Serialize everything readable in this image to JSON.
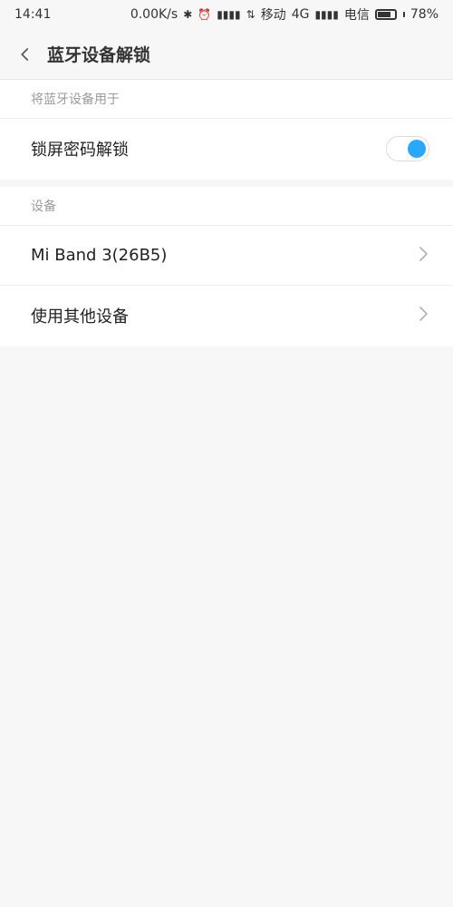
{
  "status": {
    "time": "14:41",
    "net_speed": "0.00K/s",
    "carrier1": "移动",
    "net_type": "4G",
    "carrier2": "电信",
    "battery_pct": "78%",
    "battery_level": 0.78
  },
  "header": {
    "title": "蓝牙设备解锁"
  },
  "section1": {
    "header": "将蓝牙设备用于",
    "rows": [
      {
        "label": "锁屏密码解锁",
        "toggle_on": true
      }
    ]
  },
  "section2": {
    "header": "设备",
    "rows": [
      {
        "label": "Mi Band 3(26B5)"
      },
      {
        "label": "使用其他设备"
      }
    ]
  },
  "colors": {
    "accent": "#2aa7ff",
    "bg": "#f7f7f7"
  }
}
